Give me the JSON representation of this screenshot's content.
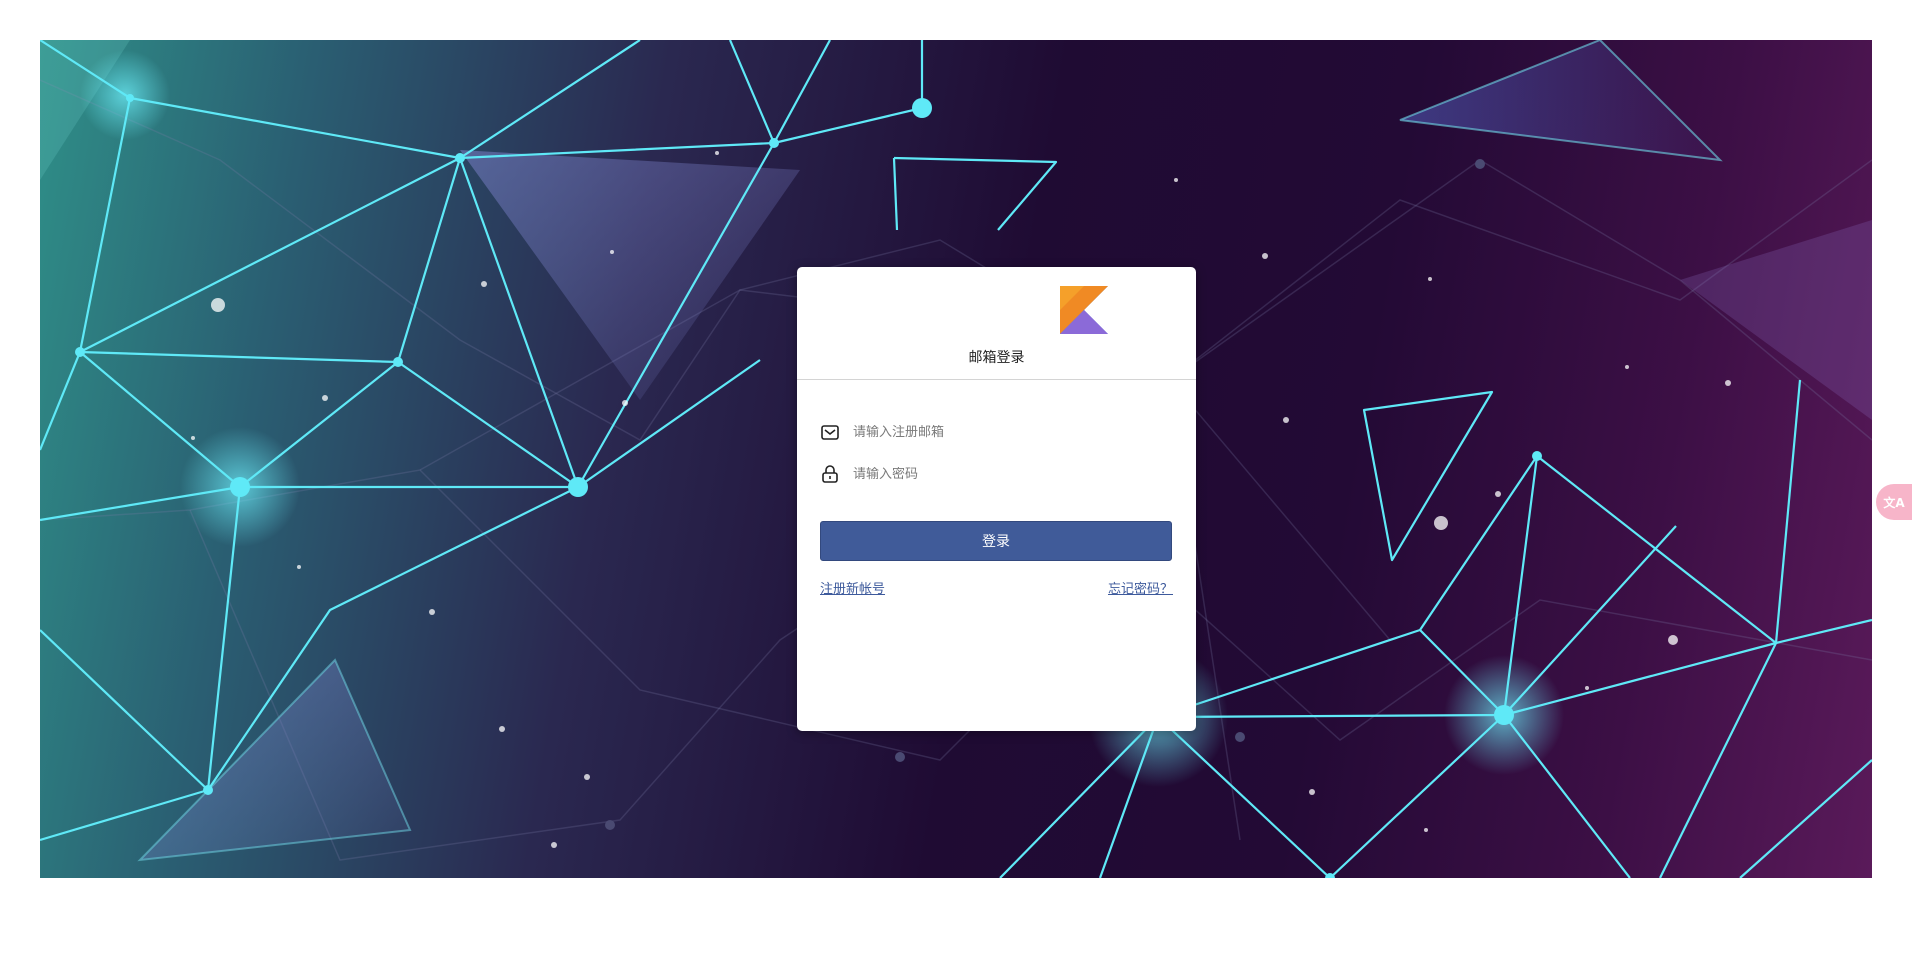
{
  "login": {
    "title": "邮箱登录",
    "email_placeholder": "请输入注册邮箱",
    "password_placeholder": "请输入密码",
    "submit_label": "登录",
    "register_link": "注册新帐号",
    "forgot_link": "忘记密码？"
  },
  "translate_widget": {
    "label": "文A"
  },
  "icons": {
    "logo": "kotlin-logo",
    "email": "envelope-icon",
    "password": "lock-icon"
  },
  "colors": {
    "primary": "#405b99",
    "link": "#3d5a9c",
    "network_line": "#5fe9f7"
  }
}
